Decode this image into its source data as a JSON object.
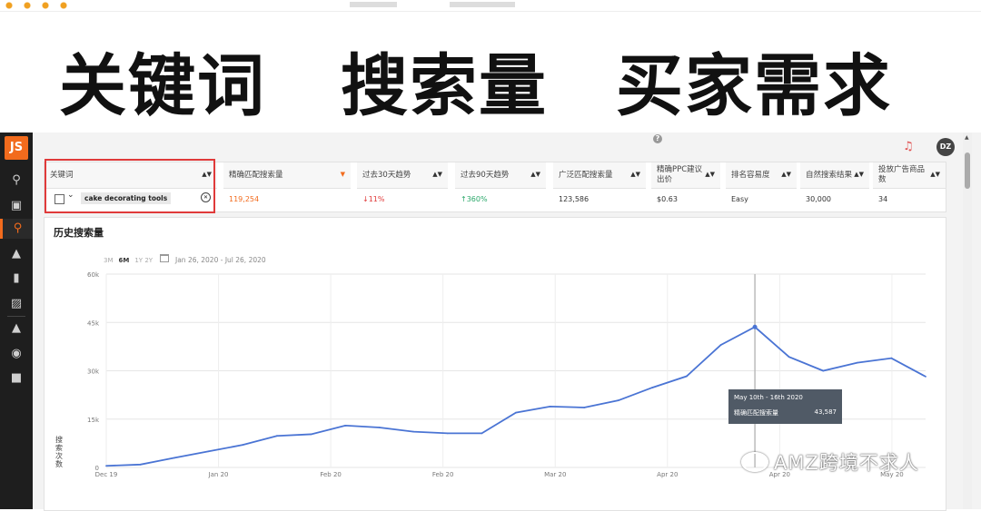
{
  "headline": {
    "word1": "关键词",
    "word2": "搜索量",
    "word3": "买家需求"
  },
  "app": {
    "logo": "JS",
    "sidebar": {
      "icons": [
        "search-icon",
        "building-icon",
        "key-icon",
        "megaphone-icon",
        "bar-chart-icon",
        "training-icon",
        "graduation-cap-icon",
        "globe-icon",
        "cart-icon"
      ],
      "active_index": 2,
      "accent_color": "#f26b1d"
    },
    "topbar": {
      "help": "?",
      "avatar_initials": "DZ"
    },
    "table": {
      "headers": [
        "关键词",
        "精确匹配搜索量",
        "过去30天趋势",
        "过去90天趋势",
        "广泛匹配搜索量",
        "精确PPC建议出价",
        "排名容易度",
        "自然搜索结果",
        "投放广告商品数"
      ],
      "keyword": "cake decorating tools",
      "exact_volume": "119,254",
      "trend_30": "↓11%",
      "trend_90": "↑360%",
      "broad_volume": "123,586",
      "ppc_bid": "$0.63",
      "ease": "Easy",
      "organic_results": "30,000",
      "sponsored_products": "34",
      "colors": {
        "down": "#e03a3a",
        "up": "#2aa86a",
        "volume": "#f26b1d"
      }
    },
    "history": {
      "title": "历史搜索量",
      "range_options": [
        "3M",
        "6M",
        "1Y",
        "2Y"
      ],
      "range_selected": "6M",
      "date_range": "Jan 26, 2020 - Jul 26, 2020",
      "y_axis_label": "搜索次数",
      "tooltip": {
        "date": "May 10th - 16th 2020",
        "series": "精确匹配搜索量",
        "value": "43,587"
      }
    }
  },
  "watermark": "AMZ跨境不求人",
  "chart_data": {
    "type": "line",
    "x_ticks": [
      "Dec 19",
      "Jan 20",
      "Feb 20",
      "Feb 20",
      "Mar 20",
      "Apr 20",
      "Apr 20",
      "May 20"
    ],
    "y_ticks": [
      "0",
      "15k",
      "30k",
      "45k",
      "60k"
    ],
    "ylim": [
      0,
      60000
    ],
    "series": [
      {
        "name": "精确匹配搜索量",
        "color": "#4a74d4",
        "x": [
          "Dec 22",
          "Dec 29",
          "Jan 5",
          "Jan 12",
          "Jan 19",
          "Jan 26",
          "Feb 2",
          "Feb 9",
          "Feb 16",
          "Feb 23",
          "Mar 1",
          "Mar 8",
          "Mar 15",
          "Mar 22",
          "Mar 29",
          "Apr 5",
          "Apr 12",
          "Apr 19",
          "Apr 26",
          "May 3",
          "May 10",
          "May 17",
          "May 24",
          "May 31",
          "Jun 7"
        ],
        "values": [
          500,
          900,
          3000,
          5000,
          7000,
          9800,
          10300,
          13000,
          12400,
          11100,
          10600,
          10600,
          17000,
          18900,
          18600,
          20800,
          24800,
          28300,
          38000,
          43587,
          34300,
          30000,
          32500,
          33900,
          28200
        ]
      }
    ]
  }
}
